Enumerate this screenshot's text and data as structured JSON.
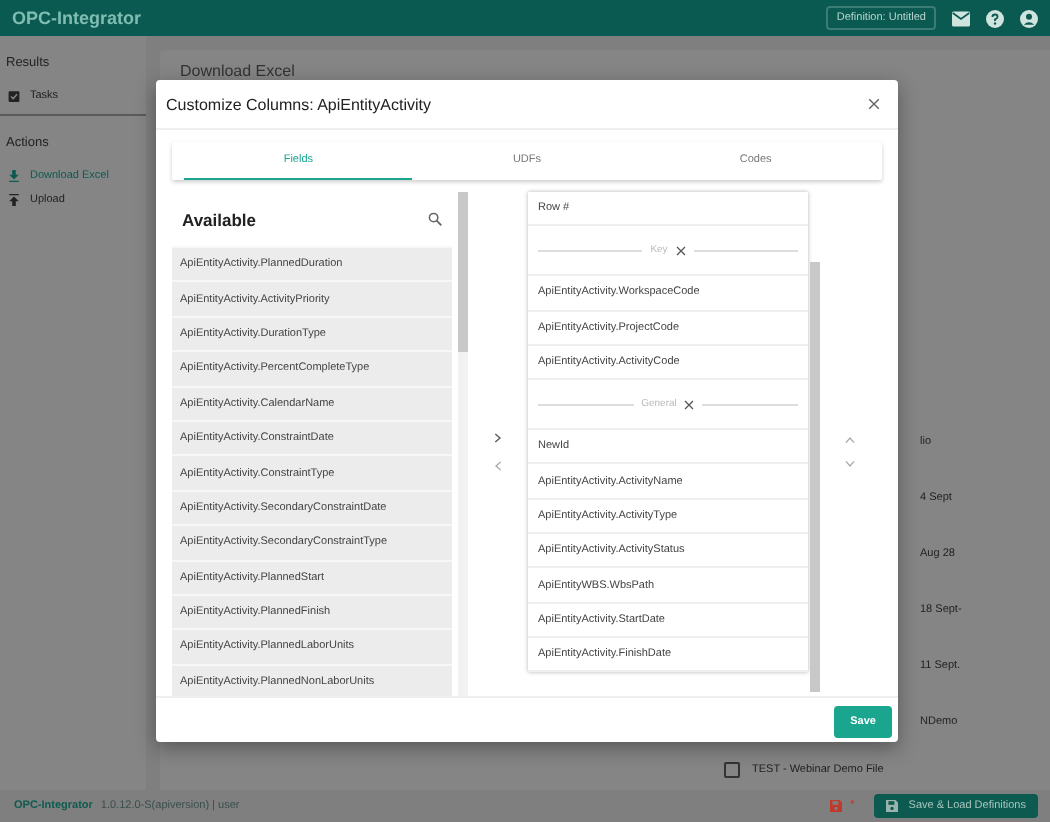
{
  "app_header": {
    "logo": "OPC-Integrator",
    "definition_button": "Definition: Untitled"
  },
  "sidebar": {
    "sections": [
      {
        "title": "Results",
        "items": [
          {
            "label": "Tasks",
            "selected": false
          }
        ]
      },
      {
        "title": "Actions",
        "items": [
          {
            "label": "Download Excel",
            "selected": true
          },
          {
            "label": "Upload",
            "selected": false
          }
        ]
      }
    ]
  },
  "main": {
    "title": "Download Excel",
    "background_rows": [
      "lio",
      "4 Sept",
      "Aug 28",
      "18 Sept-",
      "11 Sept.",
      "NDemo"
    ],
    "file_item": {
      "label": "TEST - Webinar Demo File",
      "checked": false
    }
  },
  "dialog": {
    "title": "Customize Columns: ApiEntityActivity",
    "tabs": [
      {
        "label": "Fields",
        "selected": true
      },
      {
        "label": "UDFs",
        "selected": false
      },
      {
        "label": "Codes",
        "selected": false
      }
    ],
    "available": {
      "heading": "Available",
      "items": [
        "ApiEntityActivity.PlannedDuration",
        "ApiEntityActivity.ActivityPriority",
        "ApiEntityActivity.DurationType",
        "ApiEntityActivity.PercentCompleteType",
        "ApiEntityActivity.CalendarName",
        "ApiEntityActivity.ConstraintDate",
        "ApiEntityActivity.ConstraintType",
        "ApiEntityActivity.SecondaryConstraintDate",
        "ApiEntityActivity.SecondaryConstraintType",
        "ApiEntityActivity.PlannedStart",
        "ApiEntityActivity.PlannedFinish",
        "ApiEntityActivity.PlannedLaborUnits",
        "ApiEntityActivity.PlannedNonLaborUnits"
      ]
    },
    "selected_columns": [
      {
        "kind": "field",
        "label": "Row #"
      },
      {
        "kind": "group",
        "label": "Key"
      },
      {
        "kind": "field",
        "label": "ApiEntityActivity.WorkspaceCode"
      },
      {
        "kind": "field",
        "label": "ApiEntityActivity.ProjectCode"
      },
      {
        "kind": "field",
        "label": "ApiEntityActivity.ActivityCode"
      },
      {
        "kind": "group",
        "label": "General"
      },
      {
        "kind": "field",
        "label": "NewId"
      },
      {
        "kind": "field",
        "label": "ApiEntityActivity.ActivityName"
      },
      {
        "kind": "field",
        "label": "ApiEntityActivity.ActivityType"
      },
      {
        "kind": "field",
        "label": "ApiEntityActivity.ActivityStatus"
      },
      {
        "kind": "field",
        "label": "ApiEntityWBS.WbsPath"
      },
      {
        "kind": "field",
        "label": "ApiEntityActivity.StartDate"
      },
      {
        "kind": "field",
        "label": "ApiEntityActivity.FinishDate"
      }
    ],
    "save_button": "Save"
  },
  "footer": {
    "app_name": "OPC-Integrator",
    "version": "1.0.12.0-S(apiversion) | user",
    "unsaved_mark": "*",
    "save_button": "Save & Load Definitions"
  }
}
